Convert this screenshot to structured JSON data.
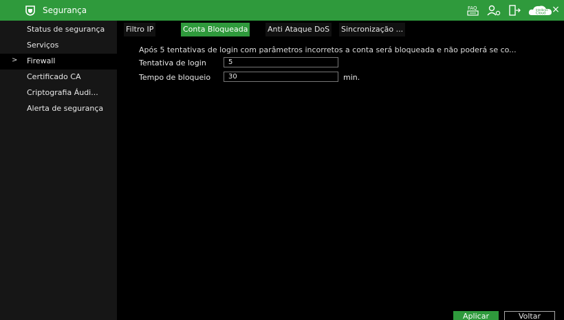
{
  "header": {
    "title": "Segurança",
    "icons": [
      "shield-icon",
      "faq-icon",
      "user-settings-icon",
      "exit-icon",
      "cloud-icon",
      "close-icon"
    ],
    "cloud_text_top": "Intelbras",
    "cloud_text_bottom": "Cloud",
    "faq_text": "FAQ",
    "close_glyph": "×"
  },
  "sidebar": {
    "items": [
      {
        "label": "Status de segurança"
      },
      {
        "label": "Serviços"
      },
      {
        "label": "Firewall",
        "marker": ">"
      },
      {
        "label": "Certificado CA"
      },
      {
        "label": "Criptografia Áudi..."
      },
      {
        "label": "Alerta de segurança"
      }
    ]
  },
  "tabs": [
    {
      "label": "Filtro IP"
    },
    {
      "label": "Conta Bloqueada"
    },
    {
      "label": "Anti Ataque DoS"
    },
    {
      "label": "Sincronização ..."
    }
  ],
  "content": {
    "notice": "Após 5 tentativas de login com parâmetros incorretos a conta será bloqueada e não poderá se co...",
    "login_attempts_label": "Tentativa de login",
    "login_attempts_value": "5",
    "lock_time_label": "Tempo de bloqueio",
    "lock_time_value": "30",
    "lock_time_unit": "min."
  },
  "buttons": {
    "apply": "Aplicar",
    "back": "Voltar"
  },
  "colors": {
    "accent": "#2f9a3c",
    "sidebar_bg": "#161616",
    "background": "#000000"
  }
}
